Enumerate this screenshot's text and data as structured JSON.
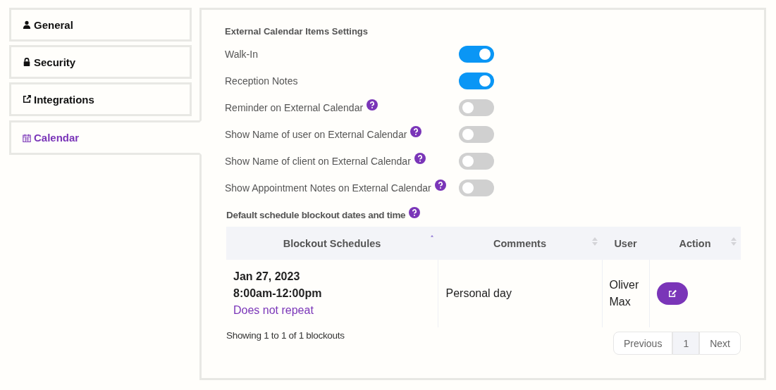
{
  "tabs": [
    {
      "label": "General",
      "selected": false
    },
    {
      "label": "Security",
      "selected": false
    },
    {
      "label": "Integrations",
      "selected": false
    },
    {
      "label": "Calendar",
      "selected": true
    }
  ],
  "settings": {
    "title": "External Calendar Items Settings",
    "items": [
      {
        "label": "Walk-In",
        "help": false,
        "on": true
      },
      {
        "label": "Reception Notes",
        "help": false,
        "on": true
      },
      {
        "label": "Reminder on External Calendar",
        "help": true,
        "on": false
      },
      {
        "label": "Show Name of user on External Calendar",
        "help": true,
        "on": false
      },
      {
        "label": "Show Name of client on External Calendar",
        "help": true,
        "on": false
      },
      {
        "label": "Show Appointment Notes on External Calendar",
        "help": true,
        "on": false
      }
    ]
  },
  "blockouts": {
    "title": "Default schedule blockout dates and time",
    "help": true,
    "columns": [
      {
        "label": "Blockout Schedules",
        "sortable": true,
        "sorted": true
      },
      {
        "label": "Comments",
        "sortable": true,
        "sorted": false
      },
      {
        "label": "User",
        "sortable": false
      },
      {
        "label": "Action",
        "sortable": true,
        "sorted": false
      }
    ],
    "rows": [
      {
        "date": "Jan 27, 2023",
        "time": "8:00am-12:00pm",
        "repeat": "Does not repeat",
        "comment": "Personal day",
        "user": "Oliver Max"
      }
    ],
    "info": "Showing 1 to 1 of 1 blockouts",
    "pagination": [
      {
        "label": "Previous",
        "selected": false
      },
      {
        "label": "1",
        "selected": true
      },
      {
        "label": "Next",
        "selected": false
      }
    ]
  }
}
